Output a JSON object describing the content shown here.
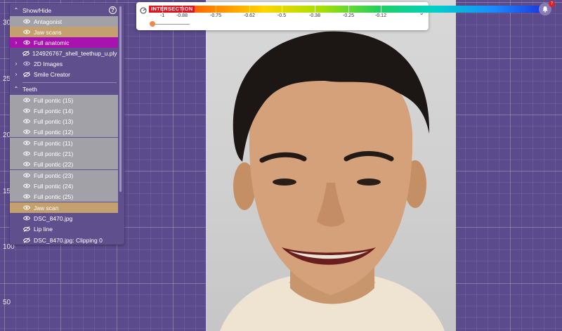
{
  "ruler": {
    "labels": [
      "30",
      "25",
      "20",
      "15",
      "100",
      "50"
    ]
  },
  "panel": {
    "show_hide_label": "Show/Hide",
    "items": [
      {
        "label": "Antagonist",
        "visible": true
      },
      {
        "label": "Jaw scans",
        "visible": true
      },
      {
        "label": "Full anatomic",
        "visible": true
      },
      {
        "label": "124926767_shell_teethup_u.ply (15",
        "visible": false
      },
      {
        "label": "2D Images",
        "visible": true
      },
      {
        "label": "Smile Creator",
        "visible": false
      }
    ],
    "teeth_label": "Teeth",
    "teeth_items": [
      {
        "label": "Full pontic (15)"
      },
      {
        "label": "Full pontic (14)"
      },
      {
        "label": "Full pontic (13)"
      },
      {
        "label": "Full pontic (12)"
      },
      {
        "label": "Full pontic (11)"
      },
      {
        "label": "Full pontic (21)"
      },
      {
        "label": "Full pontic (22)"
      },
      {
        "label": "Full pontic (23)"
      },
      {
        "label": "Full pontic (24)"
      },
      {
        "label": "Full pontic (25)"
      }
    ],
    "jaw_scan_label": "Jaw scan",
    "dsc_label": "DSC_8470.jpg",
    "lip_line_label": "Lip line",
    "clipping_label": "DSC_8470.jpg: Clipping 0"
  },
  "scale": {
    "intersection_label": "INTERSECTION",
    "ticks": [
      "-1",
      "-0.88",
      "-0.75",
      "-0.62",
      "-0.5",
      "-0.38",
      "-0.25",
      "-0.12"
    ],
    "colors": [
      "#e0141e",
      "#ff7a00",
      "#ffd400",
      "#a6e000",
      "#20d060",
      "#00d0c8",
      "#1a8cff",
      "#1a2bd8"
    ],
    "slider_value": 0
  },
  "notifications": {
    "count": "7"
  }
}
